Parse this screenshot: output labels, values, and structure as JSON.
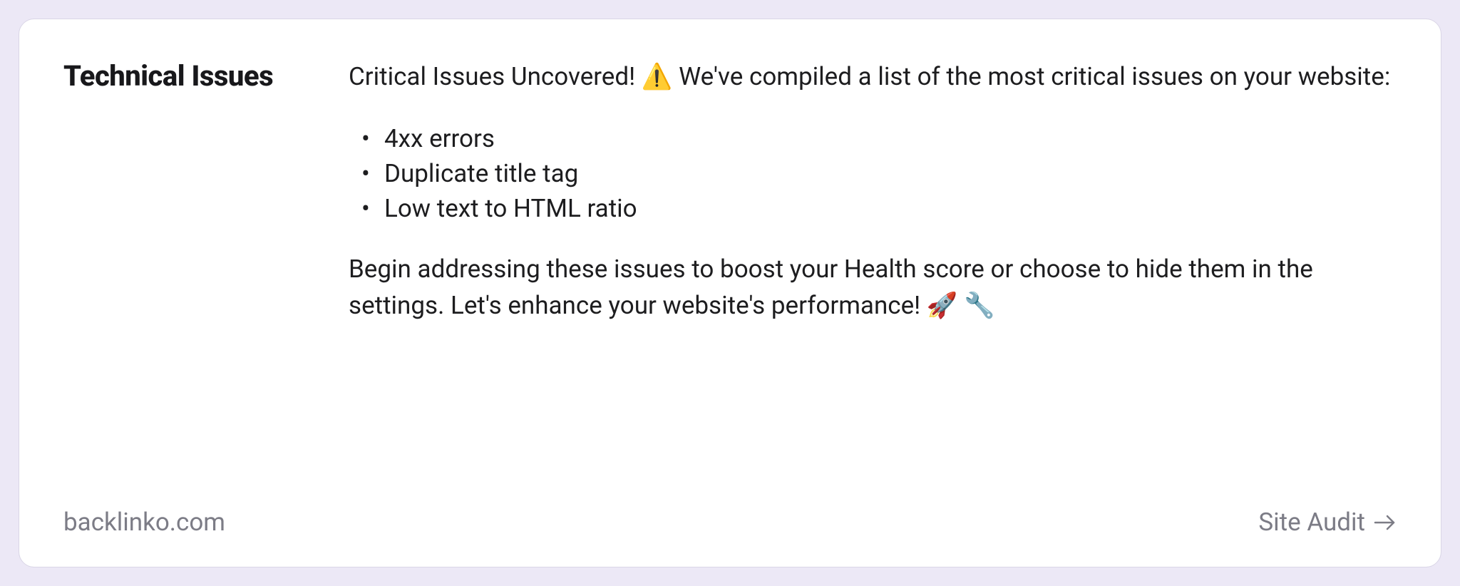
{
  "card": {
    "heading": "Technical Issues",
    "intro_prefix": "Critical Issues Uncovered! ",
    "intro_warn_emoji": "⚠️",
    "intro_suffix": " We've compiled a list of the most critical issues on your website:",
    "issues": [
      "4xx errors",
      "Duplicate title tag",
      "Low text to HTML ratio"
    ],
    "outro_text": "Begin addressing these issues to boost your Health score or choose to hide them in the settings. Let's enhance your website's performance! ",
    "outro_emoji1": "🚀",
    "outro_emoji2": "🔧"
  },
  "footer": {
    "domain": "backlinko.com",
    "link_label": "Site Audit"
  }
}
